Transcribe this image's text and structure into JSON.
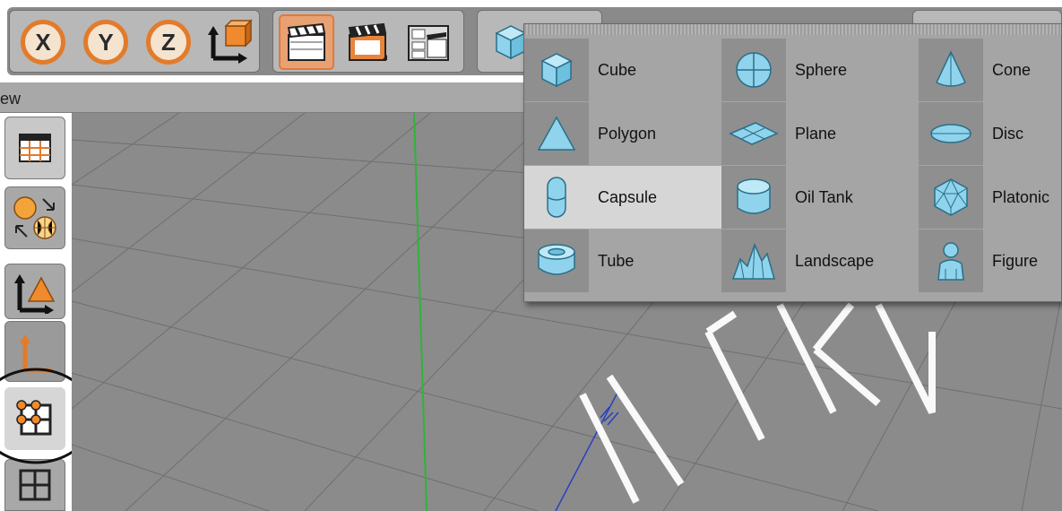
{
  "toolbar": {
    "axis_buttons": [
      {
        "label": "X"
      },
      {
        "label": "Y"
      },
      {
        "label": "Z"
      }
    ]
  },
  "view": {
    "label": "ew"
  },
  "primitives_menu": {
    "columns": [
      [
        {
          "label": "Cube",
          "icon": "cube-icon"
        },
        {
          "label": "Polygon",
          "icon": "polygon-icon"
        },
        {
          "label": "Capsule",
          "icon": "capsule-icon",
          "highlighted": true
        },
        {
          "label": "Tube",
          "icon": "tube-icon"
        }
      ],
      [
        {
          "label": "Sphere",
          "icon": "sphere-icon"
        },
        {
          "label": "Plane",
          "icon": "plane-icon"
        },
        {
          "label": "Oil Tank",
          "icon": "oil-tank-icon"
        },
        {
          "label": "Landscape",
          "icon": "landscape-icon"
        }
      ],
      [
        {
          "label": "Cone",
          "icon": "cone-icon"
        },
        {
          "label": "Disc",
          "icon": "disc-icon"
        },
        {
          "label": "Platonic",
          "icon": "platonic-icon"
        },
        {
          "label": "Figure",
          "icon": "figure-icon"
        }
      ]
    ]
  },
  "colors": {
    "accent": "#e27b2b",
    "primitive_blue": "#8fd3ec",
    "viewport": "#8b8b8b"
  },
  "watermark": {
    "text": "БУКИ"
  }
}
